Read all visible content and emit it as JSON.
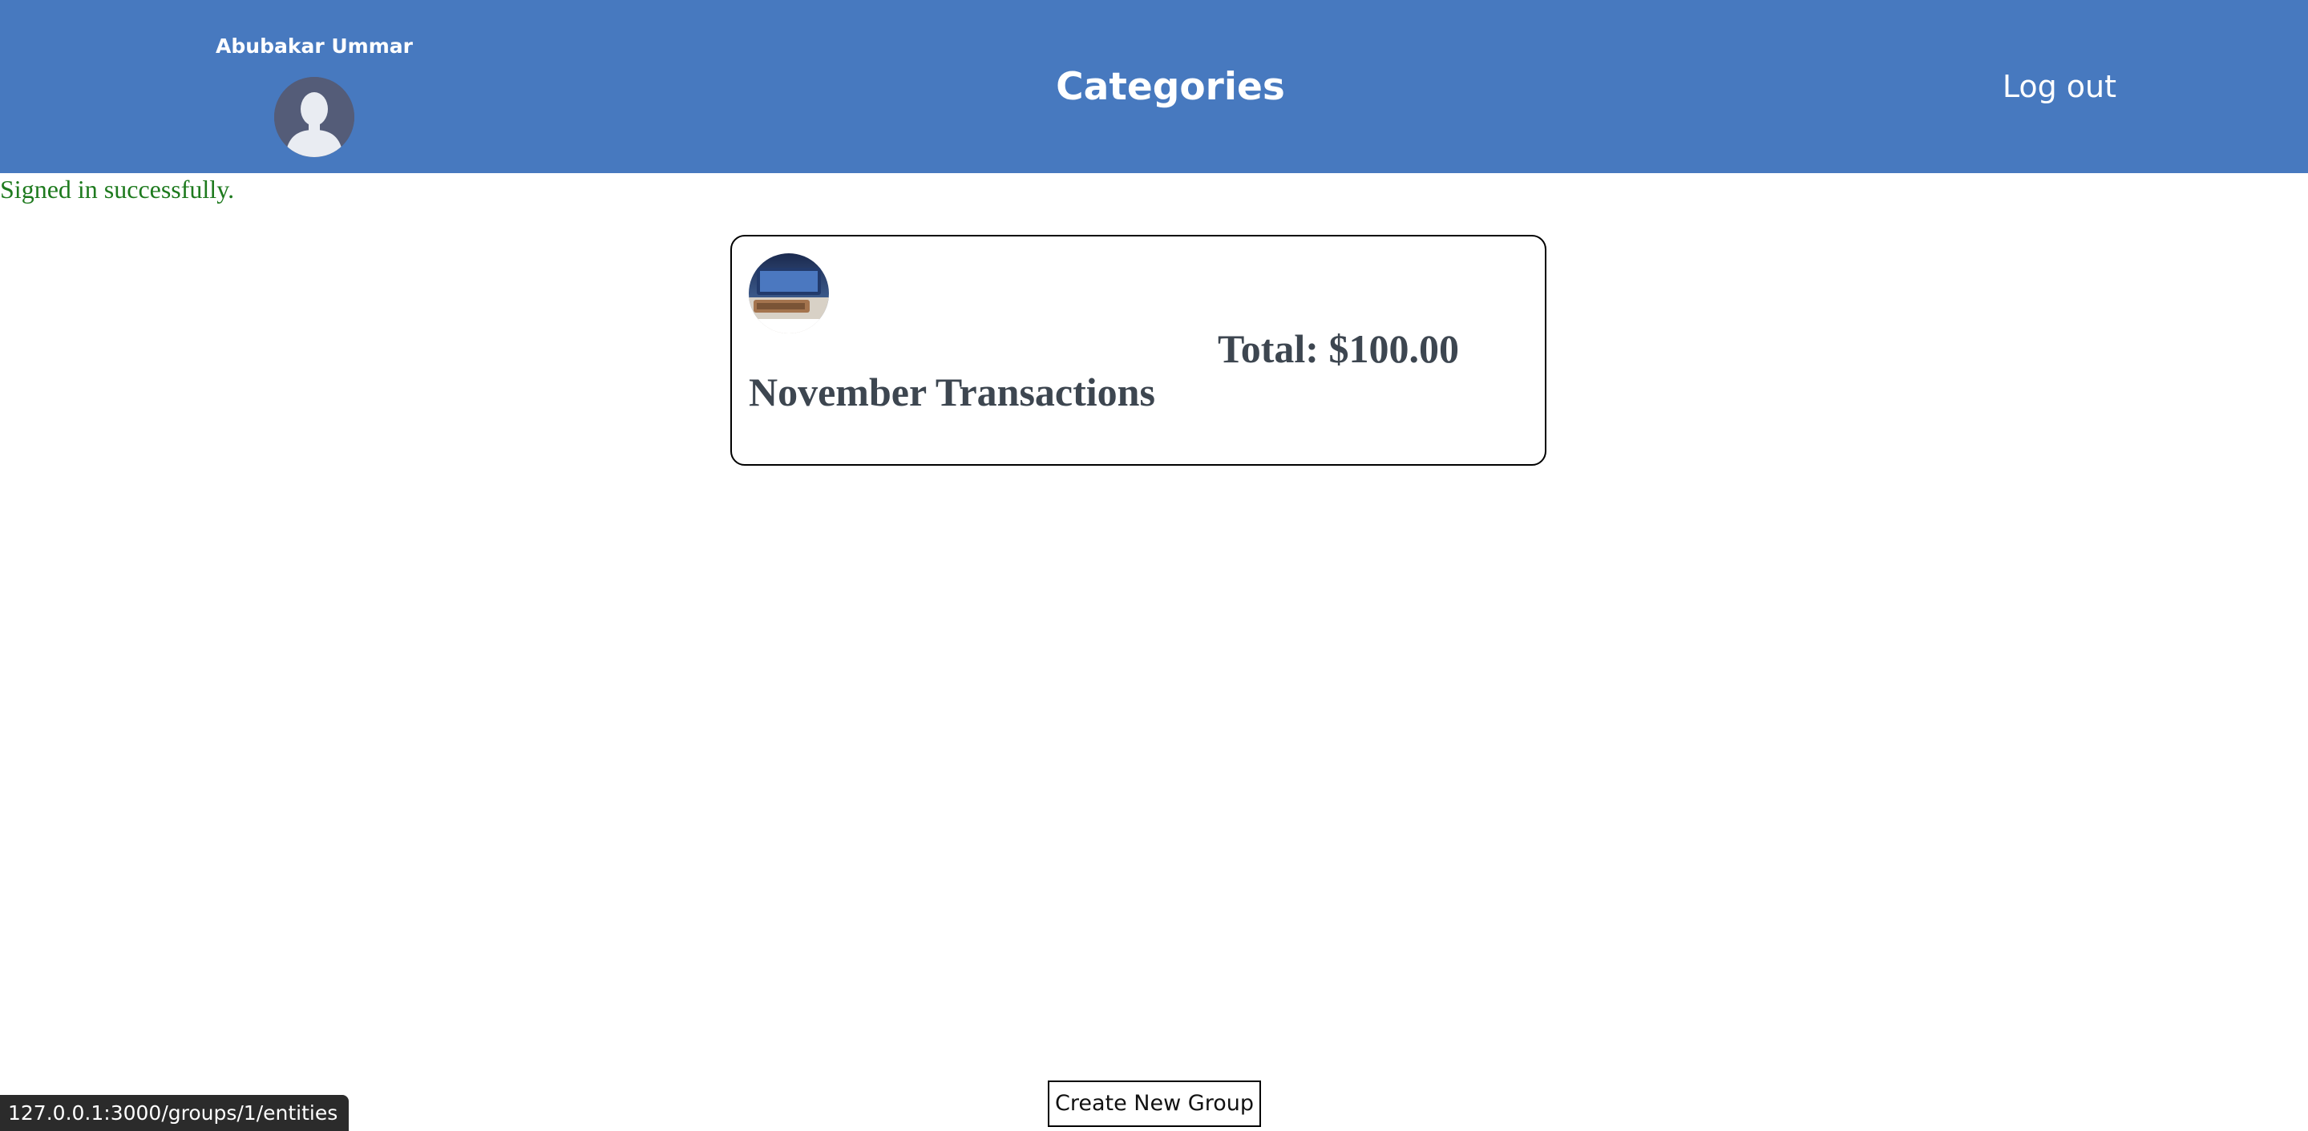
{
  "header": {
    "user_name": "Abubakar Ummar",
    "title": "Categories",
    "logout_label": "Log out",
    "avatar_icon": "user-silhouette-icon",
    "background_color": "#4779bf"
  },
  "flash": {
    "notice": "Signed in successfully.",
    "color": "#1e7a1e"
  },
  "categories": [
    {
      "name": "November Transactions",
      "total": "Total: $100.00",
      "icon": "category-thumbnail-image"
    }
  ],
  "footer": {
    "create_group_label": "Create New Group"
  },
  "browser": {
    "status_url": "127.0.0.1:3000/groups/1/entities"
  }
}
